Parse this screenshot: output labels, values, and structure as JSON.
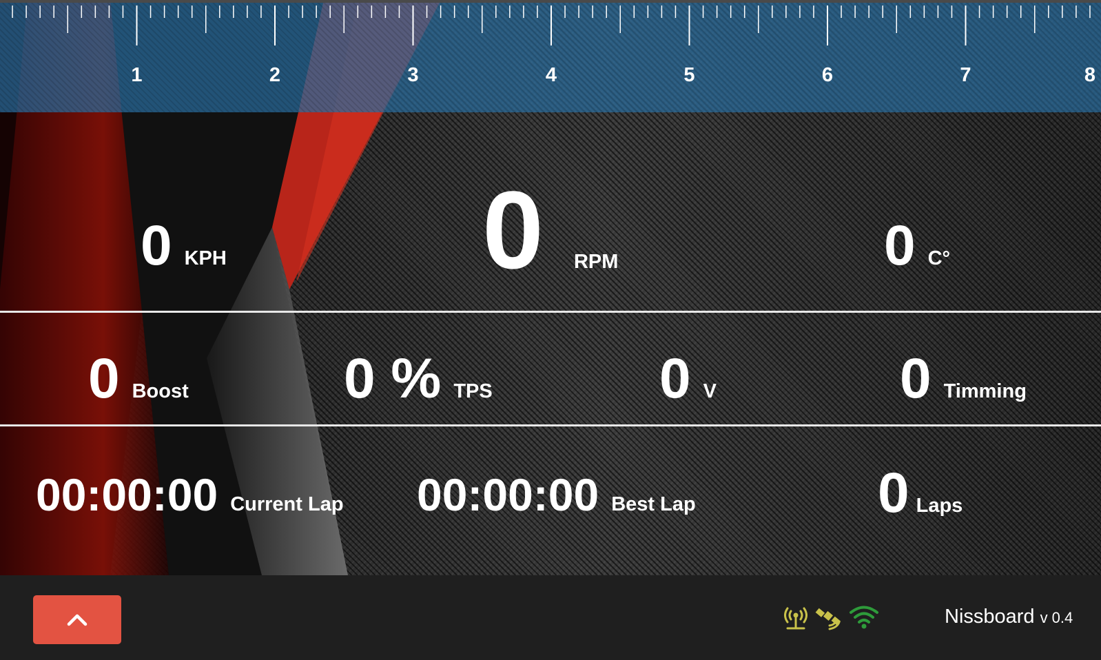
{
  "tachometer": {
    "ticks": [
      "1",
      "2",
      "3",
      "4",
      "5",
      "6",
      "7",
      "8"
    ],
    "max": 8
  },
  "gauges": {
    "speed": {
      "value": "0",
      "unit": "KPH"
    },
    "rpm": {
      "value": "0",
      "unit": "RPM"
    },
    "temp": {
      "value": "0",
      "unit": "C°"
    },
    "boost": {
      "value": "0",
      "unit": "Boost"
    },
    "tps": {
      "value": "0 %",
      "unit": "TPS"
    },
    "voltage": {
      "value": "0",
      "unit": "V"
    },
    "timing": {
      "value": "0",
      "unit": "Timming"
    },
    "current_lap": {
      "value": "00:00:00",
      "unit": "Current Lap"
    },
    "best_lap": {
      "value": "00:00:00",
      "unit": "Best Lap"
    },
    "laps": {
      "value": "0",
      "unit": "Laps"
    }
  },
  "bottom_bar": {
    "app_name": "Nissboard",
    "version": "v 0.4",
    "icons": [
      "antenna-icon",
      "satellite-icon",
      "wifi-icon"
    ]
  },
  "colors": {
    "accent_button": "#e35342",
    "antenna_icon": "#c9c24a",
    "satellite_icon": "#c9c24a",
    "wifi_icon": "#2e9b3a",
    "tach_band": "#2a6ea0"
  }
}
